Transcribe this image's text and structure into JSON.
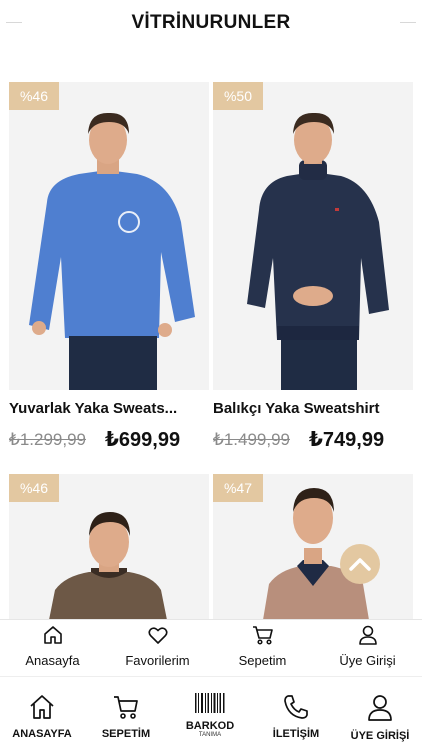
{
  "header": {
    "title": "VİTRİNURUNLER"
  },
  "products": [
    {
      "discount": "%46",
      "name": "Yuvarlak Yaka Sweats...",
      "old_price": "₺1.299,99",
      "new_price": "₺699,99",
      "sweater_color": "#4f7fd0"
    },
    {
      "discount": "%50",
      "name": "Balıkçı Yaka Sweatshirt",
      "old_price": "₺1.499,99",
      "new_price": "₺749,99",
      "sweater_color": "#26324c"
    },
    {
      "discount": "%46",
      "sweater_color": "#6d5846"
    },
    {
      "discount": "%47",
      "sweater_color": "#b88f7c"
    }
  ],
  "scroll_top_icon": "chevron-up-icon",
  "accent_color": "#e3c8a1",
  "nav_primary": [
    {
      "label": "Anasayfa",
      "icon": "home-icon"
    },
    {
      "label": "Favorilerim",
      "icon": "heart-icon"
    },
    {
      "label": "Sepetim",
      "icon": "cart-icon"
    },
    {
      "label": "Üye Girişi",
      "icon": "user-icon"
    }
  ],
  "nav_secondary": [
    {
      "label": "ANASAYFA",
      "icon": "home-icon"
    },
    {
      "label": "SEPETİM",
      "icon": "cart-icon"
    },
    {
      "label": "BARKOD",
      "sublabel": "TANIMA",
      "icon": "barcode-icon"
    },
    {
      "label": "İLETİŞİM",
      "icon": "phone-icon"
    },
    {
      "label": "ÜYE GİRİŞİ",
      "icon": "user-icon"
    }
  ]
}
